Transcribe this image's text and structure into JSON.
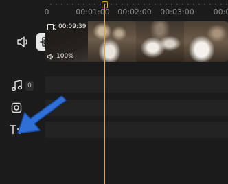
{
  "ruler": {
    "ticks": [
      "0",
      "00:01:00",
      "00:02:00",
      "00:03:00",
      "00:0"
    ]
  },
  "video_clip": {
    "duration": "00:09:39",
    "volume": "100%"
  },
  "audio_track": {
    "count": "0"
  },
  "icons": {
    "speaker": "speaker-icon",
    "detach": "detach-audio-icon",
    "music": "music-note-icon",
    "sticker": "sticker-icon",
    "text": "text-icon",
    "camera": "video-camera-icon",
    "clip_volume": "small-speaker-icon",
    "annotation": "blue-arrow-icon"
  },
  "colors": {
    "background": "#1b1b1c",
    "track": "#232324",
    "playhead": "#e0a33c",
    "arrow": "#2f6fd6"
  }
}
